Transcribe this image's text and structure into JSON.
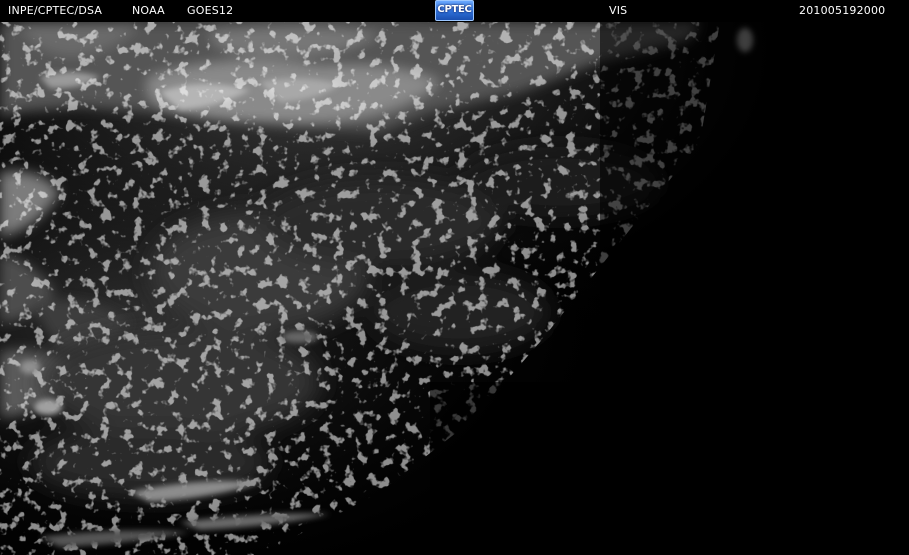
{
  "header": {
    "institution": "INPE/CPTEC/DSA",
    "agency": "NOAA",
    "satellite": "GOES12",
    "channel": "VIS",
    "timestamp": "201005192000"
  },
  "logo": {
    "text": "CPTEC",
    "color_top": "#6aa8ff",
    "color_bottom": "#1a4fb0"
  },
  "imagery": {
    "description_colors": {
      "background": "#000000",
      "cloud": "#bfbfbf"
    }
  }
}
